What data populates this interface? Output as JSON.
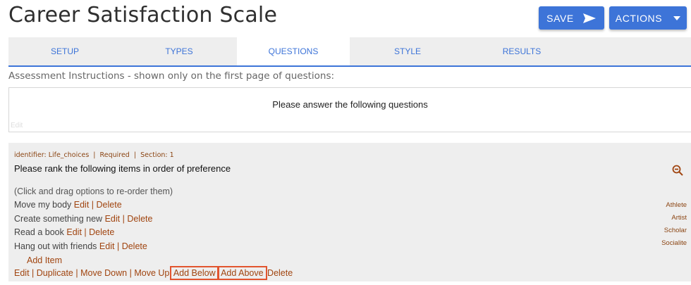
{
  "header": {
    "title": "Career Satisfaction Scale",
    "save_label": "SAVE",
    "actions_label": "ACTIONS"
  },
  "tabs": [
    {
      "label": "SETUP",
      "active": false
    },
    {
      "label": "TYPES",
      "active": false
    },
    {
      "label": "QUESTIONS",
      "active": true
    },
    {
      "label": "STYLE",
      "active": false
    },
    {
      "label": "RESULTS",
      "active": false
    }
  ],
  "instructions": {
    "label": "Assessment Instructions - shown only on the first page of questions:",
    "text": "Please answer the following questions",
    "edit_label": "Edit"
  },
  "question": {
    "meta": "identifier: Life_choices  |  Required  |  Section: 1",
    "text": "Please rank the following items in order of preference",
    "hint": "(Click and drag options to re-order them)",
    "options": [
      {
        "label": "Move my body",
        "type": "Athlete"
      },
      {
        "label": "Create something new",
        "type": "Artist"
      },
      {
        "label": "Read a book",
        "type": "Scholar"
      },
      {
        "label": "Hang out with friends",
        "type": "Socialite"
      }
    ],
    "option_edit": "Edit",
    "option_sep": "|",
    "option_delete": "Delete",
    "add_item": "Add Item",
    "actions": {
      "edit": "Edit",
      "duplicate": "Duplicate",
      "move_down": "Move Down",
      "move_up": "Move Up",
      "add_below": "Add Below",
      "add_above": "Add Above",
      "delete": "Delete",
      "sep": "|"
    }
  },
  "colors": {
    "accent": "#3d74d8",
    "link": "#a0440f",
    "highlight": "#e2542e"
  }
}
